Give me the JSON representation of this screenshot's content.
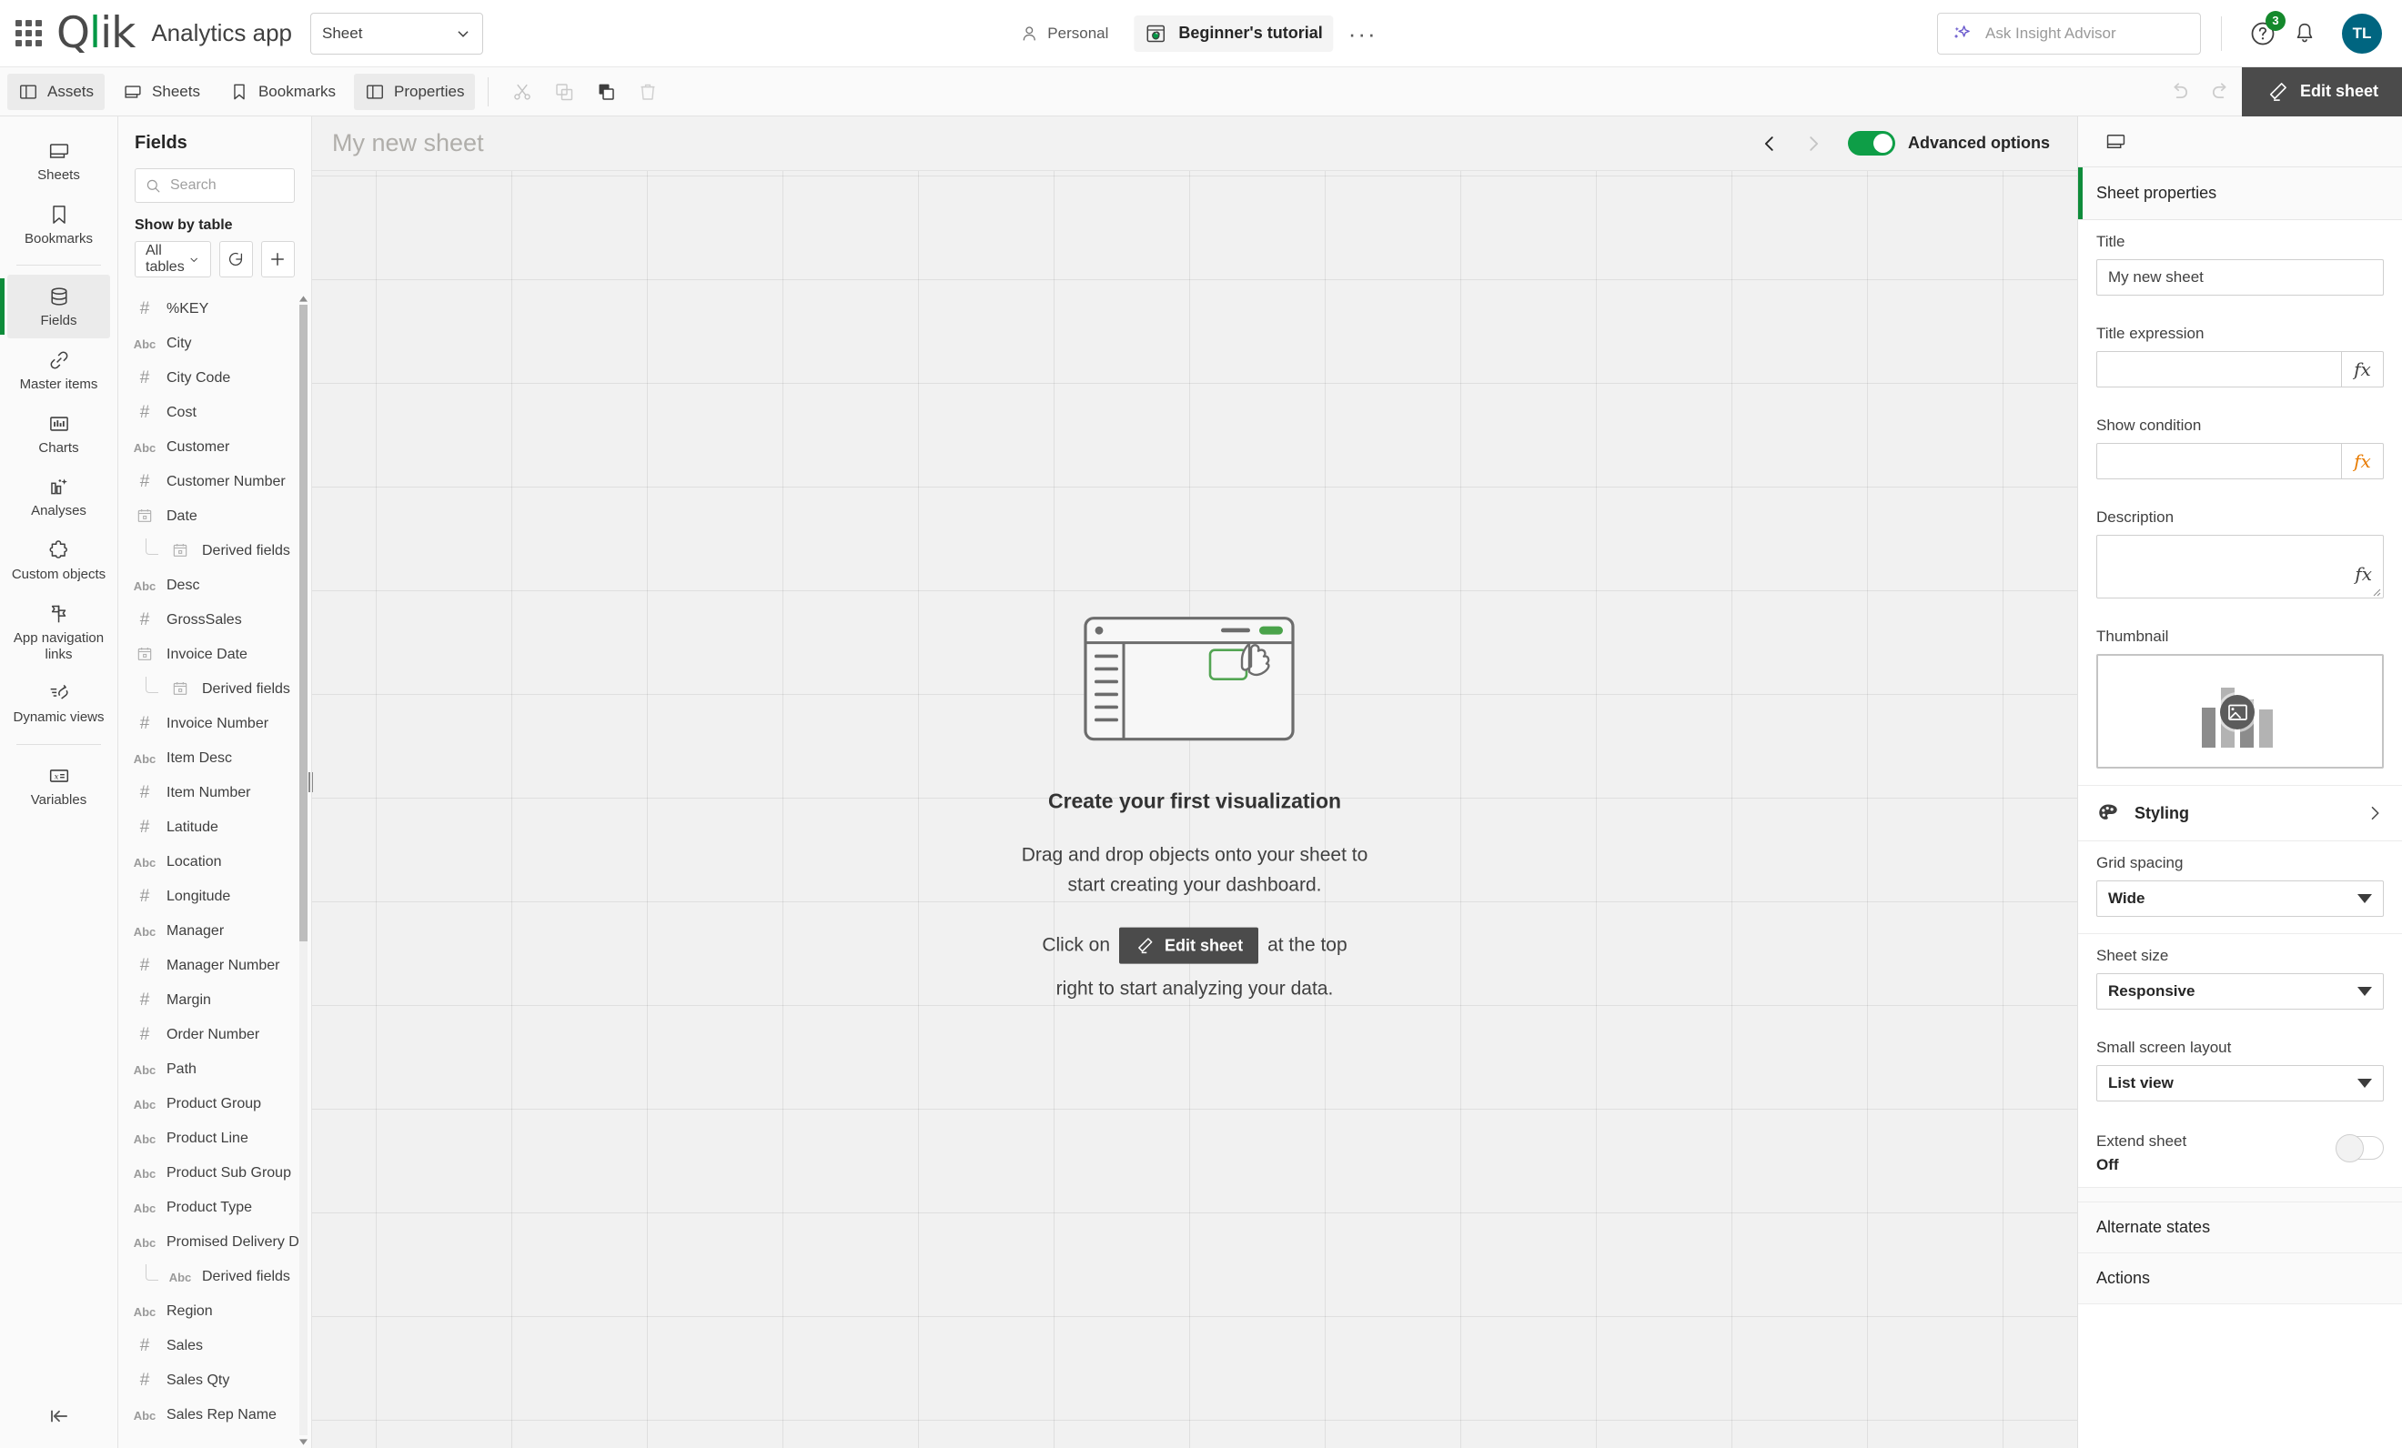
{
  "header": {
    "waffle_icon": "app-grid-icon",
    "logo_text": "Qlik",
    "app_title": "Analytics app",
    "sheet_selector_value": "Sheet",
    "space_label": "Personal",
    "app_name": "Beginner's tutorial",
    "more_label": "···",
    "insight_placeholder": "Ask Insight Advisor",
    "help_badge_count": "3",
    "avatar_initials": "TL"
  },
  "toolbar": {
    "buttons": [
      {
        "label": "Assets",
        "icon": "panel-left-icon",
        "active": true
      },
      {
        "label": "Sheets",
        "icon": "sheet-icon",
        "active": false
      },
      {
        "label": "Bookmarks",
        "icon": "bookmark-icon",
        "active": false
      },
      {
        "label": "Properties",
        "icon": "panel-right-icon",
        "active": true
      }
    ],
    "cut_icon": "scissors-icon",
    "copy_icon": "copy-icon",
    "paste_icon": "paste-icon",
    "delete_icon": "trash-icon",
    "undo_icon": "undo-icon",
    "redo_icon": "redo-icon",
    "edit_sheet_label": "Edit sheet"
  },
  "rail": {
    "items": [
      {
        "label": "Sheets",
        "icon": "sheet-icon"
      },
      {
        "label": "Bookmarks",
        "icon": "bookmark-icon"
      },
      {
        "label": "Fields",
        "icon": "database-icon"
      },
      {
        "label": "Master items",
        "icon": "link-icon"
      },
      {
        "label": "Charts",
        "icon": "bar-chart-icon"
      },
      {
        "label": "Analyses",
        "icon": "sparkle-chart-icon"
      },
      {
        "label": "Custom objects",
        "icon": "puzzle-icon"
      },
      {
        "label": "App navigation links",
        "icon": "flag-icon"
      },
      {
        "label": "Dynamic views",
        "icon": "refresh-list-icon"
      },
      {
        "label": "Variables",
        "icon": "variable-icon"
      }
    ],
    "collapse_icon": "collapse-left-icon"
  },
  "fields_panel": {
    "title": "Fields",
    "search_placeholder": "Search",
    "show_by_table_label": "Show by table",
    "table_selector_value": "All tables",
    "refresh_icon": "refresh-icon",
    "add_icon": "plus-icon",
    "fields": [
      {
        "name": "%KEY",
        "type": "#"
      },
      {
        "name": "City",
        "type": "Abc"
      },
      {
        "name": "City Code",
        "type": "#"
      },
      {
        "name": "Cost",
        "type": "#"
      },
      {
        "name": "Customer",
        "type": "Abc"
      },
      {
        "name": "Customer Number",
        "type": "#"
      },
      {
        "name": "Date",
        "type": "date"
      },
      {
        "name": "Derived fields",
        "type": "date",
        "derived": true
      },
      {
        "name": "Desc",
        "type": "Abc"
      },
      {
        "name": "GrossSales",
        "type": "#"
      },
      {
        "name": "Invoice Date",
        "type": "date"
      },
      {
        "name": "Derived fields",
        "type": "date",
        "derived": true
      },
      {
        "name": "Invoice Number",
        "type": "#"
      },
      {
        "name": "Item Desc",
        "type": "Abc"
      },
      {
        "name": "Item Number",
        "type": "#"
      },
      {
        "name": "Latitude",
        "type": "#"
      },
      {
        "name": "Location",
        "type": "Abc"
      },
      {
        "name": "Longitude",
        "type": "#"
      },
      {
        "name": "Manager",
        "type": "Abc"
      },
      {
        "name": "Manager Number",
        "type": "#"
      },
      {
        "name": "Margin",
        "type": "#"
      },
      {
        "name": "Order Number",
        "type": "#"
      },
      {
        "name": "Path",
        "type": "Abc"
      },
      {
        "name": "Product Group",
        "type": "Abc"
      },
      {
        "name": "Product Line",
        "type": "Abc"
      },
      {
        "name": "Product Sub Group",
        "type": "Abc"
      },
      {
        "name": "Product Type",
        "type": "Abc"
      },
      {
        "name": "Promised Delivery Date",
        "type": "Abc"
      },
      {
        "name": "Derived fields",
        "type": "Abc",
        "derived": true
      },
      {
        "name": "Region",
        "type": "Abc"
      },
      {
        "name": "Sales",
        "type": "#"
      },
      {
        "name": "Sales Qty",
        "type": "#"
      },
      {
        "name": "Sales Rep Name",
        "type": "Abc"
      }
    ]
  },
  "canvas": {
    "sheet_name": "My new sheet",
    "prev_icon": "chevron-left-icon",
    "next_icon": "chevron-right-icon",
    "advanced_options_label": "Advanced options",
    "advanced_options_on": true,
    "empty_state": {
      "title": "Create your first visualization",
      "line1": "Drag and drop objects onto your sheet to",
      "line2": "start creating your dashboard.",
      "cta_prefix": "Click on",
      "cta_chip": "Edit sheet",
      "cta_suffix": "at the top",
      "cta_line2": "right to start analyzing your data."
    }
  },
  "properties": {
    "tab_icon": "sheet-icon",
    "section_title": "Sheet properties",
    "title_label": "Title",
    "title_value": "My new sheet",
    "title_expression_label": "Title expression",
    "title_expression_value": "",
    "show_condition_label": "Show condition",
    "show_condition_value": "",
    "description_label": "Description",
    "description_value": "",
    "thumbnail_label": "Thumbnail",
    "thumbnail_icon": "image-placeholder-icon",
    "styling_label": "Styling",
    "styling_icon": "palette-icon",
    "grid_spacing_label": "Grid spacing",
    "grid_spacing_value": "Wide",
    "sheet_size_label": "Sheet size",
    "sheet_size_value": "Responsive",
    "small_screen_label": "Small screen layout",
    "small_screen_value": "List view",
    "extend_sheet_label": "Extend sheet",
    "extend_sheet_state": "Off",
    "alternate_states_label": "Alternate states",
    "actions_label": "Actions"
  },
  "colors": {
    "qlik_green": "#009845",
    "accent_green": "#0e8c3a",
    "toggle_green": "#0e9e47",
    "dark_btn": "#4b4b4b",
    "avatar_bg": "#006580",
    "fx_orange": "#e87b00"
  }
}
